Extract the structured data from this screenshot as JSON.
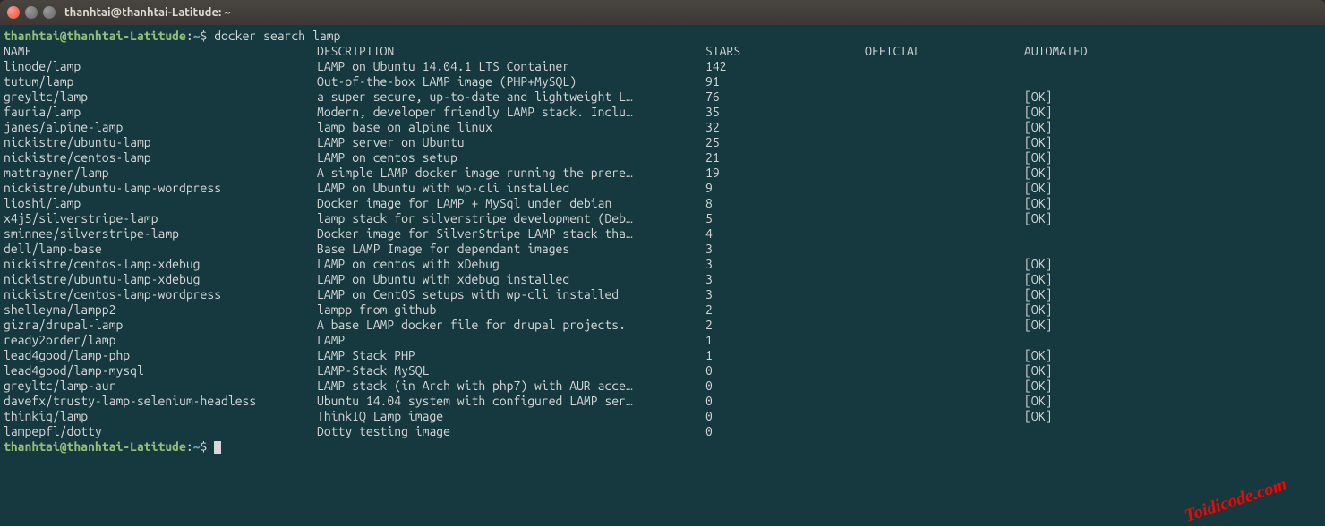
{
  "window": {
    "title": "thanhtai@thanhtai-Latitude: ~"
  },
  "prompt": {
    "user_host": "thanhtai@thanhtai-Latitude",
    "path": "~",
    "command": "docker search lamp"
  },
  "headers": {
    "name": "NAME",
    "description": "DESCRIPTION",
    "stars": "STARS",
    "official": "OFFICIAL",
    "automated": "AUTOMATED"
  },
  "rows": [
    {
      "name": "linode/lamp",
      "description": "LAMP on Ubuntu 14.04.1 LTS Container",
      "stars": "142",
      "official": "",
      "automated": ""
    },
    {
      "name": "tutum/lamp",
      "description": "Out-of-the-box LAMP image (PHP+MySQL)",
      "stars": "91",
      "official": "",
      "automated": ""
    },
    {
      "name": "greyltc/lamp",
      "description": "a super secure, up-to-date and lightweight L…",
      "stars": "76",
      "official": "",
      "automated": "[OK]"
    },
    {
      "name": "fauria/lamp",
      "description": "Modern, developer friendly LAMP stack. Inclu…",
      "stars": "35",
      "official": "",
      "automated": "[OK]"
    },
    {
      "name": "janes/alpine-lamp",
      "description": "lamp base on alpine linux",
      "stars": "32",
      "official": "",
      "automated": "[OK]"
    },
    {
      "name": "nickistre/ubuntu-lamp",
      "description": "LAMP server on Ubuntu",
      "stars": "25",
      "official": "",
      "automated": "[OK]"
    },
    {
      "name": "nickistre/centos-lamp",
      "description": "LAMP on centos setup",
      "stars": "21",
      "official": "",
      "automated": "[OK]"
    },
    {
      "name": "mattrayner/lamp",
      "description": "A simple LAMP docker image running the prere…",
      "stars": "19",
      "official": "",
      "automated": "[OK]"
    },
    {
      "name": "nickistre/ubuntu-lamp-wordpress",
      "description": "LAMP on Ubuntu with wp-cli installed",
      "stars": "9",
      "official": "",
      "automated": "[OK]"
    },
    {
      "name": "lioshi/lamp",
      "description": "Docker image for LAMP + MySql under debian",
      "stars": "8",
      "official": "",
      "automated": "[OK]"
    },
    {
      "name": "x4j5/silverstripe-lamp",
      "description": "lamp stack for silverstripe development (Deb…",
      "stars": "5",
      "official": "",
      "automated": "[OK]"
    },
    {
      "name": "sminnee/silverstripe-lamp",
      "description": "Docker image for SilverStripe LAMP stack tha…",
      "stars": "4",
      "official": "",
      "automated": ""
    },
    {
      "name": "dell/lamp-base",
      "description": "Base LAMP Image for dependant images",
      "stars": "3",
      "official": "",
      "automated": ""
    },
    {
      "name": "nickistre/centos-lamp-xdebug",
      "description": "LAMP on centos with xDebug",
      "stars": "3",
      "official": "",
      "automated": "[OK]"
    },
    {
      "name": "nickistre/ubuntu-lamp-xdebug",
      "description": "LAMP on Ubuntu with xdebug installed",
      "stars": "3",
      "official": "",
      "automated": "[OK]"
    },
    {
      "name": "nickistre/centos-lamp-wordpress",
      "description": "LAMP on CentOS setups with wp-cli installed",
      "stars": "3",
      "official": "",
      "automated": "[OK]"
    },
    {
      "name": "shelleyma/lampp2",
      "description": "lampp from github",
      "stars": "2",
      "official": "",
      "automated": "[OK]"
    },
    {
      "name": "gizra/drupal-lamp",
      "description": "A base LAMP docker file for drupal projects.",
      "stars": "2",
      "official": "",
      "automated": "[OK]"
    },
    {
      "name": "ready2order/lamp",
      "description": "LAMP",
      "stars": "1",
      "official": "",
      "automated": ""
    },
    {
      "name": "lead4good/lamp-php",
      "description": "LAMP Stack PHP",
      "stars": "1",
      "official": "",
      "automated": "[OK]"
    },
    {
      "name": "lead4good/lamp-mysql",
      "description": "LAMP-Stack MySQL",
      "stars": "0",
      "official": "",
      "automated": "[OK]"
    },
    {
      "name": "greyltc/lamp-aur",
      "description": "LAMP stack (in Arch with php7) with AUR acce…",
      "stars": "0",
      "official": "",
      "automated": "[OK]"
    },
    {
      "name": "davefx/trusty-lamp-selenium-headless",
      "description": "Ubuntu 14.04 system with configured LAMP ser…",
      "stars": "0",
      "official": "",
      "automated": "[OK]"
    },
    {
      "name": "thinkiq/lamp",
      "description": "ThinkIQ Lamp image",
      "stars": "0",
      "official": "",
      "automated": "[OK]"
    },
    {
      "name": "lampepfl/dotty",
      "description": "Dotty testing image",
      "stars": "0",
      "official": "",
      "automated": ""
    }
  ],
  "prompt2": {
    "user_host": "thanhtai@thanhtai-Latitude",
    "path": "~"
  },
  "watermark": "Toidicode.com"
}
